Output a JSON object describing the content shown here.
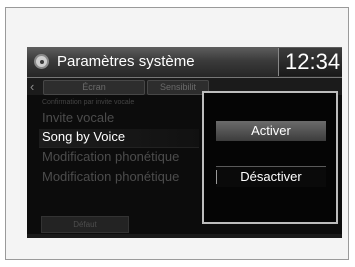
{
  "header": {
    "title": "Paramètres système",
    "clock": "12:34",
    "icon": "gear-icon"
  },
  "tabs": [
    {
      "label": "Écran"
    },
    {
      "label": "Sensibilit"
    }
  ],
  "menu": {
    "items": [
      {
        "label": "Confirmation par invite vocale"
      },
      {
        "label": "Invite vocale"
      },
      {
        "label": "Song by Voice"
      },
      {
        "label": "Modification phonétique"
      },
      {
        "label": "Modification phonétique"
      }
    ],
    "default_label": "Défaut"
  },
  "popup": {
    "options": [
      {
        "label": "Activer"
      },
      {
        "label": "Désactiver"
      }
    ]
  }
}
